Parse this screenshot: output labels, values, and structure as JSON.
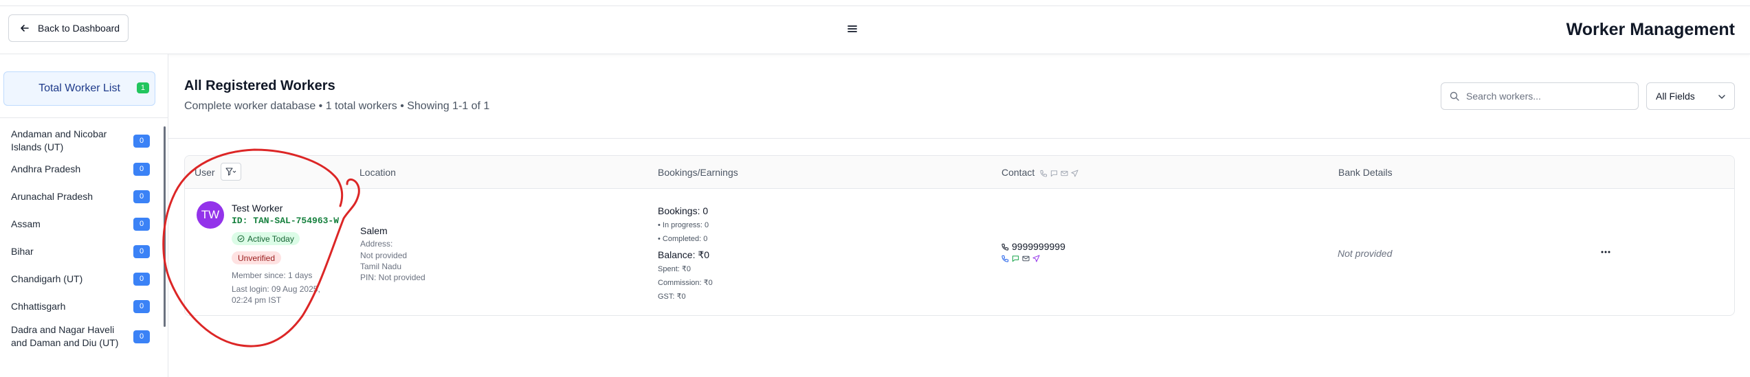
{
  "header": {
    "back_label": "Back to Dashboard",
    "title": "Worker Management"
  },
  "sidebar": {
    "total_label": "Total Worker List",
    "total_count": "1",
    "states": [
      {
        "name": "Andaman and Nicobar Islands (UT)",
        "count": "0"
      },
      {
        "name": "Andhra Pradesh",
        "count": "0"
      },
      {
        "name": "Arunachal Pradesh",
        "count": "0"
      },
      {
        "name": "Assam",
        "count": "0"
      },
      {
        "name": "Bihar",
        "count": "0"
      },
      {
        "name": "Chandigarh (UT)",
        "count": "0"
      },
      {
        "name": "Chhattisgarh",
        "count": "0"
      },
      {
        "name": "Dadra and Nagar Haveli and Daman and Diu (UT)",
        "count": "0"
      }
    ]
  },
  "main": {
    "title": "All Registered Workers",
    "subtitle": "Complete worker database • 1 total workers • Showing 1-1 of 1",
    "search_placeholder": "Search workers...",
    "filter_value": "All Fields"
  },
  "table": {
    "headers": {
      "user": "User",
      "location": "Location",
      "bookings": "Bookings/Earnings",
      "contact": "Contact",
      "bank": "Bank Details"
    },
    "row": {
      "initials": "TW",
      "name": "Test Worker",
      "id": "ID: TAN-SAL-754963-W",
      "active": "Active Today",
      "verification": "Unverified",
      "member_since": "Member since: 1 days",
      "last_login_1": "Last login: 09 Aug 2025,",
      "last_login_2": "02:24 pm IST",
      "city": "Salem",
      "address_label": "Address:",
      "address_value": "Not provided",
      "state": "Tamil Nadu",
      "pin": "PIN: Not provided",
      "bookings": "Bookings: 0",
      "in_progress": "• In progress: 0",
      "completed": "• Completed: 0",
      "balance": "Balance: ₹0",
      "spent": "Spent: ₹0",
      "commission": "Commission: ₹0",
      "gst": "GST: ₹0",
      "phone": "9999999999",
      "bank": "Not provided"
    }
  },
  "colors": {
    "accent_blue": "#3b82f6",
    "avatar_purple": "#9333ea",
    "annotation_red": "#dc2626"
  }
}
